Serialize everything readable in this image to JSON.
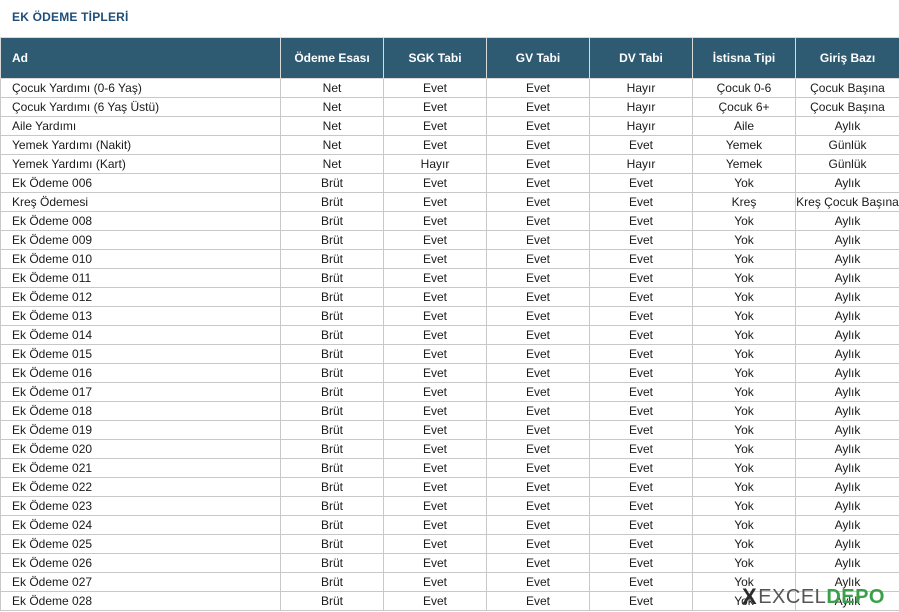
{
  "title": "EK ÖDEME TİPLERİ",
  "columns": [
    "Ad",
    "Ödeme Esası",
    "SGK Tabi",
    "GV Tabi",
    "DV Tabi",
    "İstisna Tipi",
    "Giriş Bazı"
  ],
  "rows": [
    [
      "Çocuk Yardımı (0-6 Yaş)",
      "Net",
      "Evet",
      "Evet",
      "Hayır",
      "Çocuk 0-6",
      "Çocuk Başına"
    ],
    [
      "Çocuk Yardımı (6 Yaş Üstü)",
      "Net",
      "Evet",
      "Evet",
      "Hayır",
      "Çocuk 6+",
      "Çocuk Başına"
    ],
    [
      "Aile Yardımı",
      "Net",
      "Evet",
      "Evet",
      "Hayır",
      "Aile",
      "Aylık"
    ],
    [
      "Yemek Yardımı (Nakit)",
      "Net",
      "Evet",
      "Evet",
      "Evet",
      "Yemek",
      "Günlük"
    ],
    [
      "Yemek Yardımı (Kart)",
      "Net",
      "Hayır",
      "Evet",
      "Hayır",
      "Yemek",
      "Günlük"
    ],
    [
      "Ek Ödeme 006",
      "Brüt",
      "Evet",
      "Evet",
      "Evet",
      "Yok",
      "Aylık"
    ],
    [
      "Kreş Ödemesi",
      "Brüt",
      "Evet",
      "Evet",
      "Evet",
      "Kreş",
      "Kreş Çocuk Başına"
    ],
    [
      "Ek Ödeme 008",
      "Brüt",
      "Evet",
      "Evet",
      "Evet",
      "Yok",
      "Aylık"
    ],
    [
      "Ek Ödeme 009",
      "Brüt",
      "Evet",
      "Evet",
      "Evet",
      "Yok",
      "Aylık"
    ],
    [
      "Ek Ödeme 010",
      "Brüt",
      "Evet",
      "Evet",
      "Evet",
      "Yok",
      "Aylık"
    ],
    [
      "Ek Ödeme 011",
      "Brüt",
      "Evet",
      "Evet",
      "Evet",
      "Yok",
      "Aylık"
    ],
    [
      "Ek Ödeme 012",
      "Brüt",
      "Evet",
      "Evet",
      "Evet",
      "Yok",
      "Aylık"
    ],
    [
      "Ek Ödeme 013",
      "Brüt",
      "Evet",
      "Evet",
      "Evet",
      "Yok",
      "Aylık"
    ],
    [
      "Ek Ödeme 014",
      "Brüt",
      "Evet",
      "Evet",
      "Evet",
      "Yok",
      "Aylık"
    ],
    [
      "Ek Ödeme 015",
      "Brüt",
      "Evet",
      "Evet",
      "Evet",
      "Yok",
      "Aylık"
    ],
    [
      "Ek Ödeme 016",
      "Brüt",
      "Evet",
      "Evet",
      "Evet",
      "Yok",
      "Aylık"
    ],
    [
      "Ek Ödeme 017",
      "Brüt",
      "Evet",
      "Evet",
      "Evet",
      "Yok",
      "Aylık"
    ],
    [
      "Ek Ödeme 018",
      "Brüt",
      "Evet",
      "Evet",
      "Evet",
      "Yok",
      "Aylık"
    ],
    [
      "Ek Ödeme 019",
      "Brüt",
      "Evet",
      "Evet",
      "Evet",
      "Yok",
      "Aylık"
    ],
    [
      "Ek Ödeme 020",
      "Brüt",
      "Evet",
      "Evet",
      "Evet",
      "Yok",
      "Aylık"
    ],
    [
      "Ek Ödeme 021",
      "Brüt",
      "Evet",
      "Evet",
      "Evet",
      "Yok",
      "Aylık"
    ],
    [
      "Ek Ödeme 022",
      "Brüt",
      "Evet",
      "Evet",
      "Evet",
      "Yok",
      "Aylık"
    ],
    [
      "Ek Ödeme 023",
      "Brüt",
      "Evet",
      "Evet",
      "Evet",
      "Yok",
      "Aylık"
    ],
    [
      "Ek Ödeme 024",
      "Brüt",
      "Evet",
      "Evet",
      "Evet",
      "Yok",
      "Aylık"
    ],
    [
      "Ek Ödeme 025",
      "Brüt",
      "Evet",
      "Evet",
      "Evet",
      "Yok",
      "Aylık"
    ],
    [
      "Ek Ödeme 026",
      "Brüt",
      "Evet",
      "Evet",
      "Evet",
      "Yok",
      "Aylık"
    ],
    [
      "Ek Ödeme 027",
      "Brüt",
      "Evet",
      "Evet",
      "Evet",
      "Yok",
      "Aylık"
    ],
    [
      "Ek Ödeme 028",
      "Brüt",
      "Evet",
      "Evet",
      "Evet",
      "Yok",
      "Aylık"
    ]
  ],
  "watermark": {
    "mark": "X",
    "part1": "EXCEL",
    "part2": "DEPO"
  },
  "colors": {
    "header_bg": "#2e5a72",
    "title": "#1f4e79",
    "brand_green": "#3aa14a"
  }
}
